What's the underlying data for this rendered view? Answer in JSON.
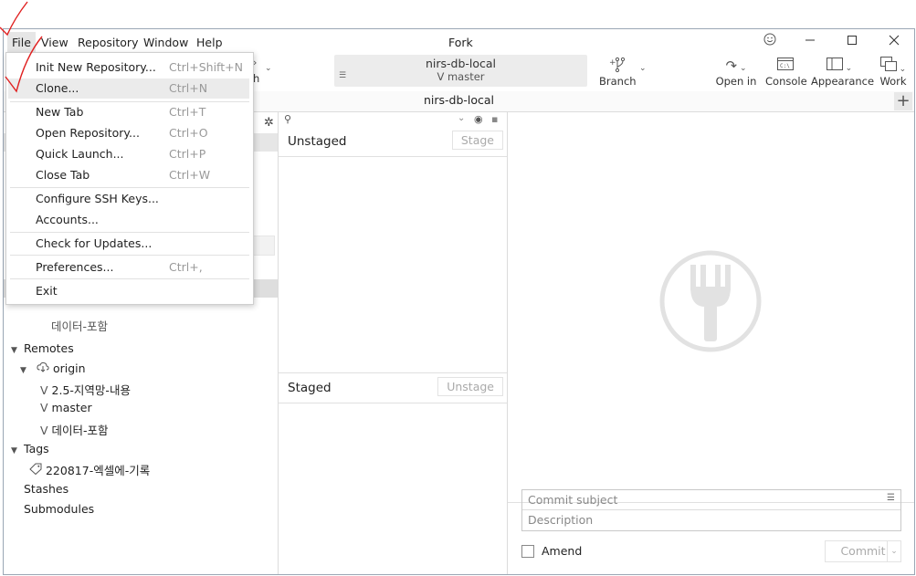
{
  "menubar": {
    "file": "File",
    "view": "View",
    "repository": "Repository",
    "window": "Window",
    "help": "Help"
  },
  "app_title": "Fork",
  "toolbar": {
    "repo_name": "nirs-db-local",
    "branch_icon": "ⴸ",
    "branch_name": "master",
    "hidden_label": "h",
    "branch_btn": "Branch",
    "open_in": "Open in",
    "console": "Console",
    "appearance": "Appearance",
    "work": "Work"
  },
  "tab": {
    "title": "nirs-db-local"
  },
  "file_menu": {
    "items": [
      {
        "label": "Init New Repository...",
        "shortcut": "Ctrl+Shift+N"
      },
      {
        "label": "Clone...",
        "shortcut": "Ctrl+N"
      },
      {
        "label": "New Tab",
        "shortcut": "Ctrl+T"
      },
      {
        "label": "Open Repository...",
        "shortcut": "Ctrl+O"
      },
      {
        "label": "Quick Launch...",
        "shortcut": "Ctrl+P"
      },
      {
        "label": "Close Tab",
        "shortcut": "Ctrl+W"
      },
      {
        "label": "Configure SSH Keys...",
        "shortcut": ""
      },
      {
        "label": "Accounts...",
        "shortcut": ""
      },
      {
        "label": "Check for Updates...",
        "shortcut": ""
      },
      {
        "label": "Preferences...",
        "shortcut": "Ctrl+,"
      },
      {
        "label": "Exit",
        "shortcut": ""
      }
    ]
  },
  "sidebar": {
    "partial_item": "데이터-포함",
    "remotes": "Remotes",
    "origin": "origin",
    "remote_branches": [
      "2.5-지역망-내용",
      "master",
      "데이터-포함"
    ],
    "tags": "Tags",
    "tag_items": [
      "220817-엑셀에-기록"
    ],
    "stashes": "Stashes",
    "submodules": "Submodules"
  },
  "changes": {
    "unstaged": "Unstaged",
    "stage_btn": "Stage",
    "staged": "Staged",
    "unstage_btn": "Unstage"
  },
  "commit": {
    "subject_placeholder": "Commit subject",
    "description_placeholder": "Description",
    "amend": "Amend",
    "commit_btn": "Commit"
  },
  "colors": {
    "annotation": "#e02020",
    "highlight": "#ebebeb"
  }
}
